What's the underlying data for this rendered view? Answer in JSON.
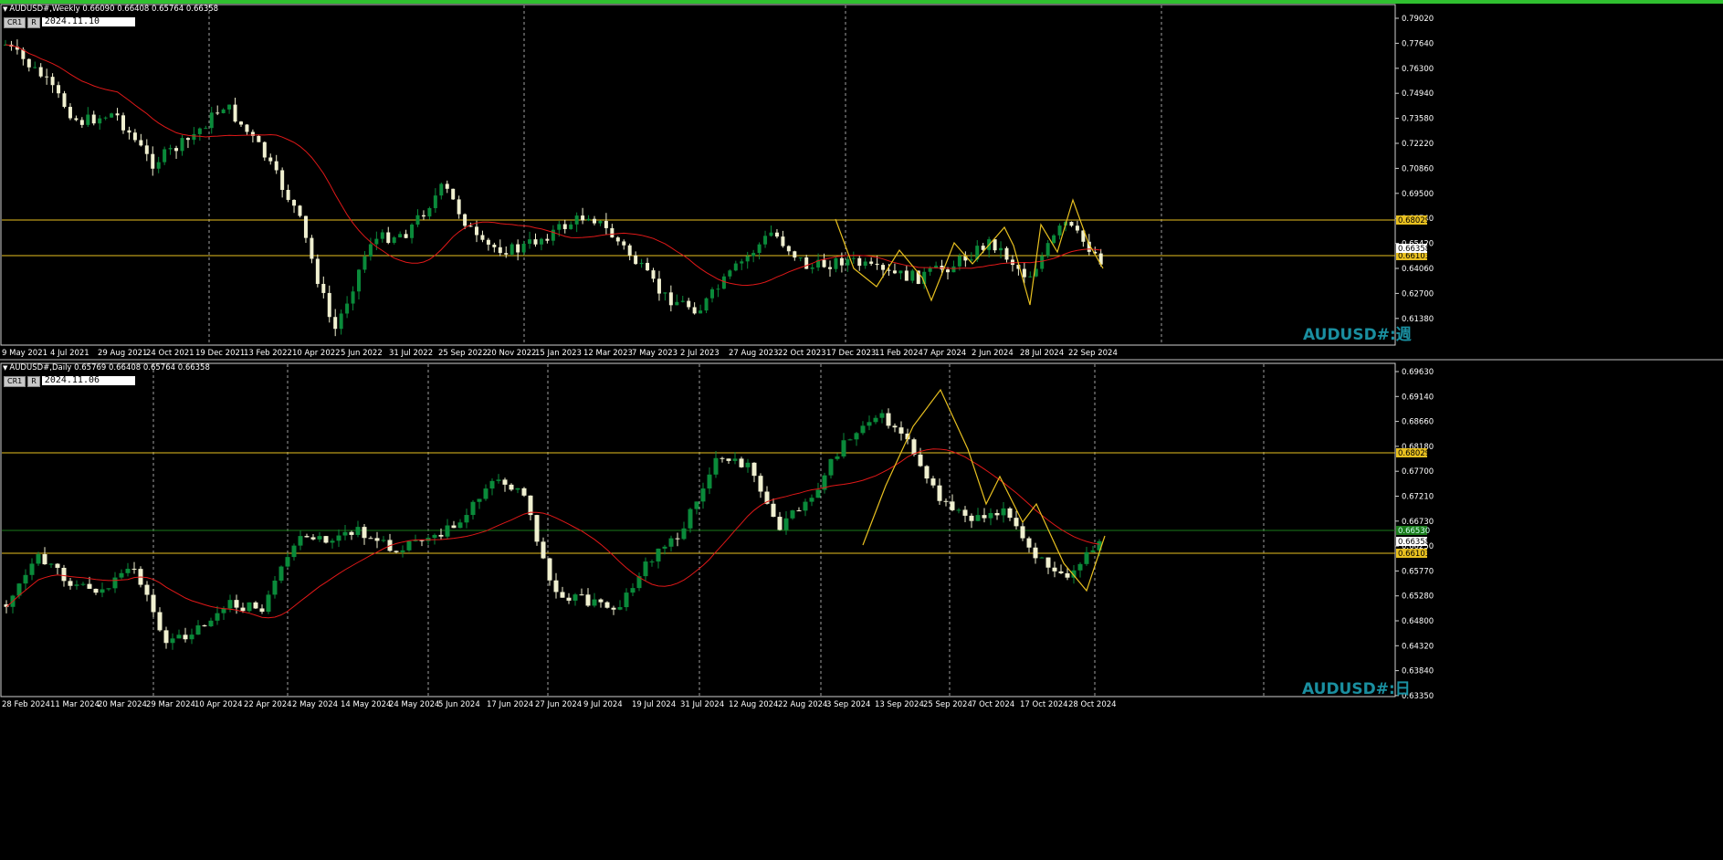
{
  "weekly": {
    "symbol_info": "AUDUSD#,Weekly  0.66090 0.66408 0.65764 0.66358",
    "btn_cr": "CR1",
    "btn_r": "R",
    "date_box": "2024.11.10 00:00",
    "watermark": "AUDUSD#:週",
    "price_labels": [
      "0.79020",
      "0.77640",
      "0.76300",
      "0.74940",
      "0.73580",
      "0.72220",
      "0.70860",
      "0.69500",
      "0.66740",
      "0.65420",
      "0.64060",
      "0.62700",
      "0.61380"
    ],
    "hline_labels": [
      "0.68029",
      "0.66103"
    ],
    "current_price": "0.66358",
    "date_labels": [
      "9 May 2021",
      "4 Jul 2021",
      "29 Aug 2021",
      "24 Oct 2021",
      "19 Dec 2021",
      "13 Feb 2022",
      "10 Apr 2022",
      "5 Jun 2022",
      "31 Jul 2022",
      "25 Sep 2022",
      "20 Nov 2022",
      "15 Jan 2023",
      "12 Mar 2023",
      "7 May 2023",
      "2 Jul 2023",
      "27 Aug 2023",
      "22 Oct 2023",
      "17 Dec 2023",
      "11 Feb 2024",
      "7 Apr 2024",
      "2 Jun 2024",
      "28 Jul 2024",
      "22 Sep 2024"
    ]
  },
  "daily": {
    "symbol_info": "AUDUSD#,Daily  0.65769 0.66408 0.65764 0.66358",
    "btn_cr": "CR1",
    "btn_r": "R",
    "date_box": "2024.11.06 00:00",
    "watermark": "AUDUSD#:日",
    "price_labels": [
      "0.69630",
      "0.69140",
      "0.68660",
      "0.68180",
      "0.67700",
      "0.67210",
      "0.66730",
      "0.66250",
      "0.65770",
      "0.65280",
      "0.64800",
      "0.64320",
      "0.63840",
      "0.63350"
    ],
    "hline_labels": [
      "0.68029",
      "0.66103"
    ],
    "green_label": "0.66530",
    "current_price": "0.66358",
    "date_labels": [
      "28 Feb 2024",
      "11 Mar 2024",
      "20 Mar 2024",
      "29 Mar 2024",
      "10 Apr 2024",
      "22 Apr 2024",
      "2 May 2024",
      "14 May 2024",
      "24 May 2024",
      "5 Jun 2024",
      "17 Jun 2024",
      "27 Jun 2024",
      "9 Jul 2024",
      "19 Jul 2024",
      "31 Jul 2024",
      "12 Aug 2024",
      "22 Aug 2024",
      "3 Sep 2024",
      "13 Sep 2024",
      "25 Sep 2024",
      "7 Oct 2024",
      "17 Oct 2024",
      "28 Oct 2024"
    ]
  },
  "colors": {
    "bull": "#0a8a3a",
    "bear": "#f0f0d0",
    "ma": "#e01818",
    "hline": "#e8c020",
    "zigzag": "#e8c020",
    "grid": "#c8c8c8",
    "green_line": "#1a7a1a"
  }
}
